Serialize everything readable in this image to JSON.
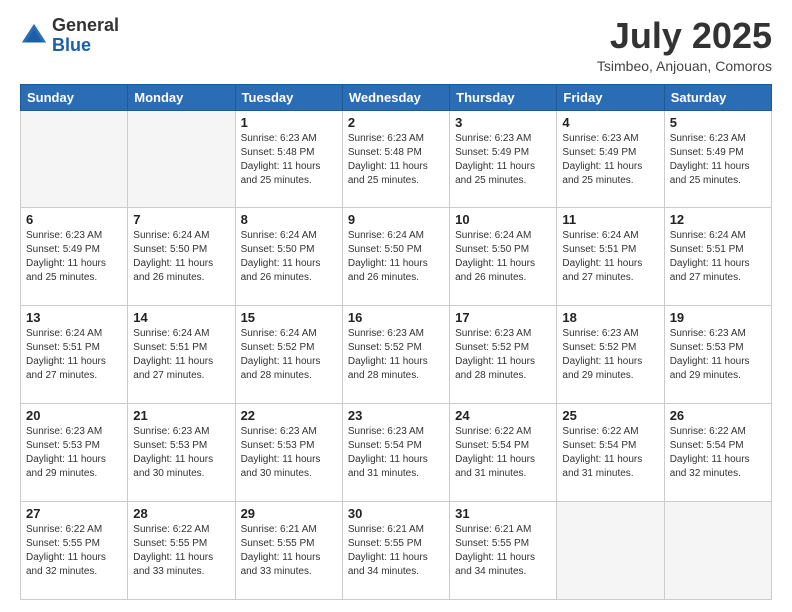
{
  "header": {
    "logo_general": "General",
    "logo_blue": "Blue",
    "month_title": "July 2025",
    "location": "Tsimbeo, Anjouan, Comoros"
  },
  "weekdays": [
    "Sunday",
    "Monday",
    "Tuesday",
    "Wednesday",
    "Thursday",
    "Friday",
    "Saturday"
  ],
  "weeks": [
    [
      {
        "day": "",
        "sunrise": "",
        "sunset": "",
        "daylight": ""
      },
      {
        "day": "",
        "sunrise": "",
        "sunset": "",
        "daylight": ""
      },
      {
        "day": "1",
        "sunrise": "Sunrise: 6:23 AM",
        "sunset": "Sunset: 5:48 PM",
        "daylight": "Daylight: 11 hours and 25 minutes."
      },
      {
        "day": "2",
        "sunrise": "Sunrise: 6:23 AM",
        "sunset": "Sunset: 5:48 PM",
        "daylight": "Daylight: 11 hours and 25 minutes."
      },
      {
        "day": "3",
        "sunrise": "Sunrise: 6:23 AM",
        "sunset": "Sunset: 5:49 PM",
        "daylight": "Daylight: 11 hours and 25 minutes."
      },
      {
        "day": "4",
        "sunrise": "Sunrise: 6:23 AM",
        "sunset": "Sunset: 5:49 PM",
        "daylight": "Daylight: 11 hours and 25 minutes."
      },
      {
        "day": "5",
        "sunrise": "Sunrise: 6:23 AM",
        "sunset": "Sunset: 5:49 PM",
        "daylight": "Daylight: 11 hours and 25 minutes."
      }
    ],
    [
      {
        "day": "6",
        "sunrise": "Sunrise: 6:23 AM",
        "sunset": "Sunset: 5:49 PM",
        "daylight": "Daylight: 11 hours and 25 minutes."
      },
      {
        "day": "7",
        "sunrise": "Sunrise: 6:24 AM",
        "sunset": "Sunset: 5:50 PM",
        "daylight": "Daylight: 11 hours and 26 minutes."
      },
      {
        "day": "8",
        "sunrise": "Sunrise: 6:24 AM",
        "sunset": "Sunset: 5:50 PM",
        "daylight": "Daylight: 11 hours and 26 minutes."
      },
      {
        "day": "9",
        "sunrise": "Sunrise: 6:24 AM",
        "sunset": "Sunset: 5:50 PM",
        "daylight": "Daylight: 11 hours and 26 minutes."
      },
      {
        "day": "10",
        "sunrise": "Sunrise: 6:24 AM",
        "sunset": "Sunset: 5:50 PM",
        "daylight": "Daylight: 11 hours and 26 minutes."
      },
      {
        "day": "11",
        "sunrise": "Sunrise: 6:24 AM",
        "sunset": "Sunset: 5:51 PM",
        "daylight": "Daylight: 11 hours and 27 minutes."
      },
      {
        "day": "12",
        "sunrise": "Sunrise: 6:24 AM",
        "sunset": "Sunset: 5:51 PM",
        "daylight": "Daylight: 11 hours and 27 minutes."
      }
    ],
    [
      {
        "day": "13",
        "sunrise": "Sunrise: 6:24 AM",
        "sunset": "Sunset: 5:51 PM",
        "daylight": "Daylight: 11 hours and 27 minutes."
      },
      {
        "day": "14",
        "sunrise": "Sunrise: 6:24 AM",
        "sunset": "Sunset: 5:51 PM",
        "daylight": "Daylight: 11 hours and 27 minutes."
      },
      {
        "day": "15",
        "sunrise": "Sunrise: 6:24 AM",
        "sunset": "Sunset: 5:52 PM",
        "daylight": "Daylight: 11 hours and 28 minutes."
      },
      {
        "day": "16",
        "sunrise": "Sunrise: 6:23 AM",
        "sunset": "Sunset: 5:52 PM",
        "daylight": "Daylight: 11 hours and 28 minutes."
      },
      {
        "day": "17",
        "sunrise": "Sunrise: 6:23 AM",
        "sunset": "Sunset: 5:52 PM",
        "daylight": "Daylight: 11 hours and 28 minutes."
      },
      {
        "day": "18",
        "sunrise": "Sunrise: 6:23 AM",
        "sunset": "Sunset: 5:52 PM",
        "daylight": "Daylight: 11 hours and 29 minutes."
      },
      {
        "day": "19",
        "sunrise": "Sunrise: 6:23 AM",
        "sunset": "Sunset: 5:53 PM",
        "daylight": "Daylight: 11 hours and 29 minutes."
      }
    ],
    [
      {
        "day": "20",
        "sunrise": "Sunrise: 6:23 AM",
        "sunset": "Sunset: 5:53 PM",
        "daylight": "Daylight: 11 hours and 29 minutes."
      },
      {
        "day": "21",
        "sunrise": "Sunrise: 6:23 AM",
        "sunset": "Sunset: 5:53 PM",
        "daylight": "Daylight: 11 hours and 30 minutes."
      },
      {
        "day": "22",
        "sunrise": "Sunrise: 6:23 AM",
        "sunset": "Sunset: 5:53 PM",
        "daylight": "Daylight: 11 hours and 30 minutes."
      },
      {
        "day": "23",
        "sunrise": "Sunrise: 6:23 AM",
        "sunset": "Sunset: 5:54 PM",
        "daylight": "Daylight: 11 hours and 31 minutes."
      },
      {
        "day": "24",
        "sunrise": "Sunrise: 6:22 AM",
        "sunset": "Sunset: 5:54 PM",
        "daylight": "Daylight: 11 hours and 31 minutes."
      },
      {
        "day": "25",
        "sunrise": "Sunrise: 6:22 AM",
        "sunset": "Sunset: 5:54 PM",
        "daylight": "Daylight: 11 hours and 31 minutes."
      },
      {
        "day": "26",
        "sunrise": "Sunrise: 6:22 AM",
        "sunset": "Sunset: 5:54 PM",
        "daylight": "Daylight: 11 hours and 32 minutes."
      }
    ],
    [
      {
        "day": "27",
        "sunrise": "Sunrise: 6:22 AM",
        "sunset": "Sunset: 5:55 PM",
        "daylight": "Daylight: 11 hours and 32 minutes."
      },
      {
        "day": "28",
        "sunrise": "Sunrise: 6:22 AM",
        "sunset": "Sunset: 5:55 PM",
        "daylight": "Daylight: 11 hours and 33 minutes."
      },
      {
        "day": "29",
        "sunrise": "Sunrise: 6:21 AM",
        "sunset": "Sunset: 5:55 PM",
        "daylight": "Daylight: 11 hours and 33 minutes."
      },
      {
        "day": "30",
        "sunrise": "Sunrise: 6:21 AM",
        "sunset": "Sunset: 5:55 PM",
        "daylight": "Daylight: 11 hours and 34 minutes."
      },
      {
        "day": "31",
        "sunrise": "Sunrise: 6:21 AM",
        "sunset": "Sunset: 5:55 PM",
        "daylight": "Daylight: 11 hours and 34 minutes."
      },
      {
        "day": "",
        "sunrise": "",
        "sunset": "",
        "daylight": ""
      },
      {
        "day": "",
        "sunrise": "",
        "sunset": "",
        "daylight": ""
      }
    ]
  ]
}
